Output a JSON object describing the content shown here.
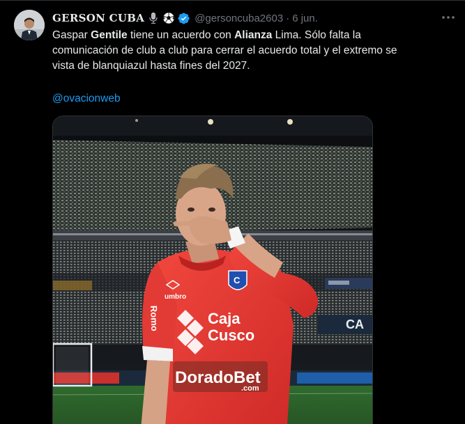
{
  "tweet": {
    "display_name": "GERSON CUBA",
    "handle": "@gersoncuba2603",
    "separator": "·",
    "date": "6 jun.",
    "name_emojis": [
      "microphone-icon",
      "soccer-ball-icon"
    ],
    "verified": true,
    "lines": [
      {
        "pre": "Gaspar ",
        "bold1": "Gentile",
        "mid": " tiene un acuerdo con ",
        "bold2": "Alianza",
        "post": " Lima. Sólo falta la"
      },
      {
        "text": "comunicación de club a club para cerrar el acuerdo total y el extremo se"
      },
      {
        "text": "vista de blanquiazul hasta fines del 2027."
      }
    ],
    "mention": "@ovacionweb",
    "media": {
      "icon": "player-photo",
      "jersey_sponsor_top": "Caja",
      "jersey_sponsor_bottom": "Cusco",
      "jersey_main_sponsor": "DoradoBet",
      "jersey_main_sponsor_suffix": ".com",
      "jersey_brand": "umbro",
      "jersey_sleeve": "Romo",
      "board_text": "CA"
    }
  },
  "colors": {
    "background": "#000000",
    "text": "#e7e9ea",
    "muted": "#71767b",
    "link": "#1d9bf0",
    "verified": "#1d9bf0",
    "jersey": "#e8312e"
  }
}
